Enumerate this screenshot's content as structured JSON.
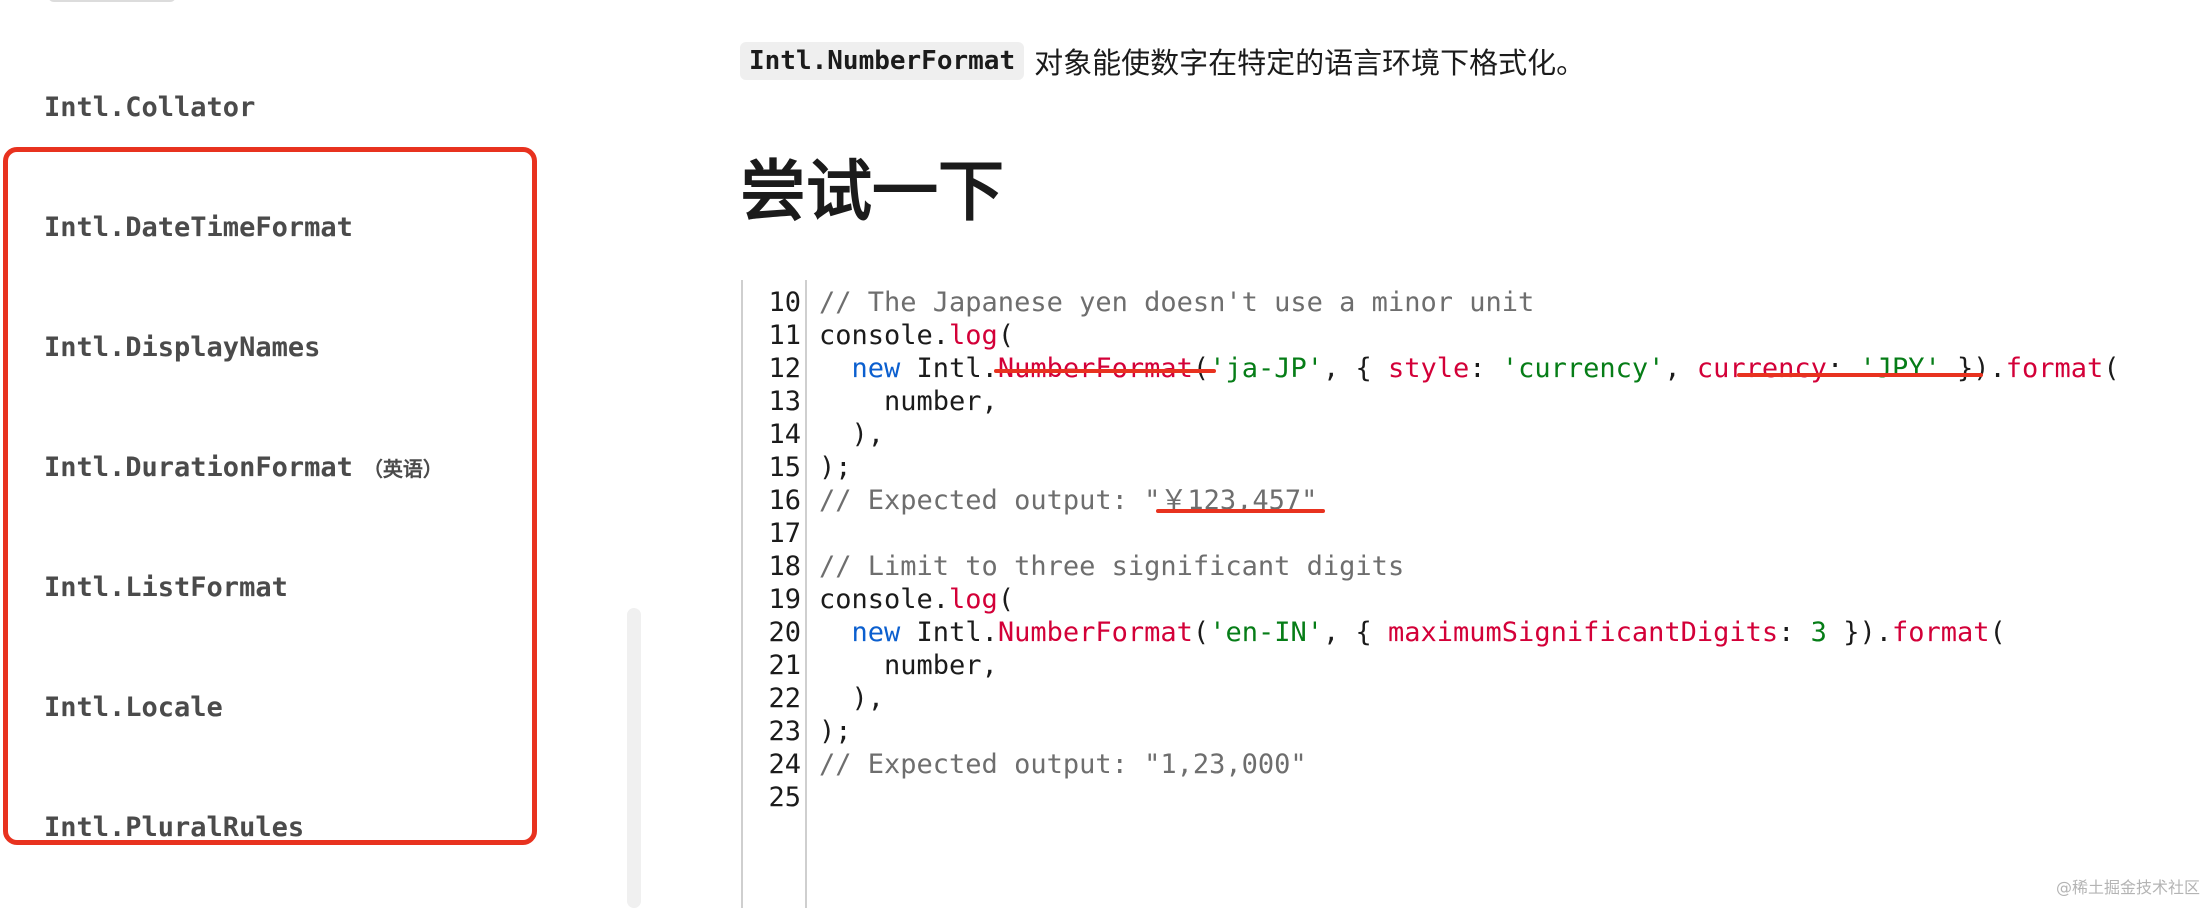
{
  "sidebar": {
    "items": [
      {
        "label": "Intl.Collator",
        "tag": ""
      },
      {
        "label": "Intl.DateTimeFormat",
        "tag": ""
      },
      {
        "label": "Intl.DisplayNames",
        "tag": ""
      },
      {
        "label": "Intl.DurationFormat",
        "tag": "（英语）"
      },
      {
        "label": "Intl.ListFormat",
        "tag": ""
      },
      {
        "label": "Intl.Locale",
        "tag": ""
      },
      {
        "label": "Intl.PluralRules",
        "tag": ""
      }
    ]
  },
  "main": {
    "intro_code": "Intl.NumberFormat",
    "intro_text": "对象能使数字在特定的语言环境下格式化。",
    "section_heading": "尝试一下"
  },
  "editor": {
    "lines": [
      {
        "no": "10",
        "tokens": [
          {
            "t": "comment",
            "v": "// The Japanese yen doesn't use a minor unit"
          }
        ]
      },
      {
        "no": "11",
        "tokens": [
          {
            "t": "plain",
            "v": "console."
          },
          {
            "t": "func",
            "v": "log"
          },
          {
            "t": "plain",
            "v": "("
          }
        ]
      },
      {
        "no": "12",
        "tokens": [
          {
            "t": "plain",
            "v": "  "
          },
          {
            "t": "keyword",
            "v": "new"
          },
          {
            "t": "plain",
            "v": " Intl."
          },
          {
            "t": "func",
            "v": "NumberFormat"
          },
          {
            "t": "plain",
            "v": "("
          },
          {
            "t": "string",
            "v": "'ja-JP'"
          },
          {
            "t": "plain",
            "v": ", { "
          },
          {
            "t": "prop",
            "v": "style"
          },
          {
            "t": "plain",
            "v": ": "
          },
          {
            "t": "string",
            "v": "'currency'"
          },
          {
            "t": "plain",
            "v": ", "
          },
          {
            "t": "prop",
            "v": "currency"
          },
          {
            "t": "plain",
            "v": ": "
          },
          {
            "t": "string",
            "v": "'JPY'"
          },
          {
            "t": "plain",
            "v": " })."
          },
          {
            "t": "func",
            "v": "format"
          },
          {
            "t": "plain",
            "v": "("
          }
        ]
      },
      {
        "no": "13",
        "tokens": [
          {
            "t": "plain",
            "v": "    number,"
          }
        ]
      },
      {
        "no": "14",
        "tokens": [
          {
            "t": "plain",
            "v": "  ),"
          }
        ]
      },
      {
        "no": "15",
        "tokens": [
          {
            "t": "plain",
            "v": ");"
          }
        ]
      },
      {
        "no": "16",
        "tokens": [
          {
            "t": "comment",
            "v": "// Expected output: \"￥123,457\""
          }
        ]
      },
      {
        "no": "17",
        "tokens": []
      },
      {
        "no": "18",
        "tokens": [
          {
            "t": "comment",
            "v": "// Limit to three significant digits"
          }
        ]
      },
      {
        "no": "19",
        "tokens": [
          {
            "t": "plain",
            "v": "console."
          },
          {
            "t": "func",
            "v": "log"
          },
          {
            "t": "plain",
            "v": "("
          }
        ]
      },
      {
        "no": "20",
        "tokens": [
          {
            "t": "plain",
            "v": "  "
          },
          {
            "t": "keyword",
            "v": "new"
          },
          {
            "t": "plain",
            "v": " Intl."
          },
          {
            "t": "func",
            "v": "NumberFormat"
          },
          {
            "t": "plain",
            "v": "("
          },
          {
            "t": "string",
            "v": "'en-IN'"
          },
          {
            "t": "plain",
            "v": ", { "
          },
          {
            "t": "prop",
            "v": "maximumSignificantDigits"
          },
          {
            "t": "plain",
            "v": ": "
          },
          {
            "t": "num",
            "v": "3"
          },
          {
            "t": "plain",
            "v": " })."
          },
          {
            "t": "func",
            "v": "format"
          },
          {
            "t": "plain",
            "v": "("
          }
        ]
      },
      {
        "no": "21",
        "tokens": [
          {
            "t": "plain",
            "v": "    number,"
          }
        ]
      },
      {
        "no": "22",
        "tokens": [
          {
            "t": "plain",
            "v": "  ),"
          }
        ]
      },
      {
        "no": "23",
        "tokens": [
          {
            "t": "plain",
            "v": ");"
          }
        ]
      },
      {
        "no": "24",
        "tokens": [
          {
            "t": "comment",
            "v": "// Expected output: \"1,23,000\""
          }
        ]
      },
      {
        "no": "25",
        "tokens": []
      }
    ]
  },
  "annotations": {
    "color": "#e8321f"
  },
  "watermark": "@稀土掘金技术社区"
}
